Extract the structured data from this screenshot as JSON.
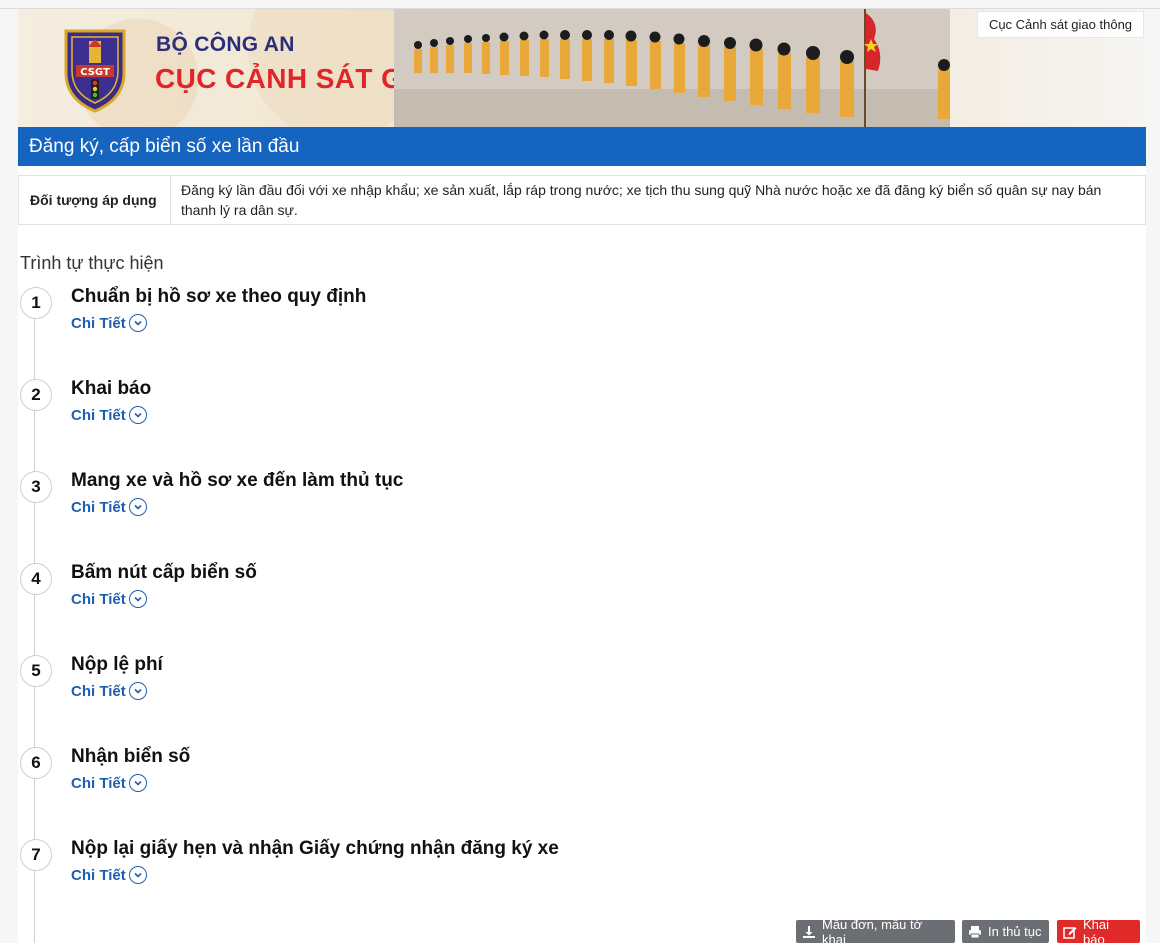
{
  "header": {
    "brand_top": "BỘ CÔNG AN",
    "brand_main": "CỤC CẢNH SÁT GIAO THÔNG",
    "logo_text": "CSGT",
    "agency_chip": "Cục Cảnh sát giao thông"
  },
  "procedure": {
    "title": "Đăng ký, cấp biển số xe lần đầu",
    "applicable_label": "Đối tượng áp dụng",
    "applicable_value": "Đăng ký lần đầu đối với xe nhập khẩu; xe sản xuất, lắp ráp trong nước; xe tịch thu sung quỹ Nhà nước hoặc xe đã đăng ký biển số quân sự nay bán thanh lý ra dân sự."
  },
  "steps_section": {
    "title": "Trình tự thực hiện",
    "detail_label": "Chi Tiết",
    "steps": [
      {
        "number": "1",
        "title": "Chuẩn bị hồ sơ xe theo quy định"
      },
      {
        "number": "2",
        "title": "Khai báo"
      },
      {
        "number": "3",
        "title": "Mang xe và hồ sơ xe đến làm thủ tục"
      },
      {
        "number": "4",
        "title": "Bấm nút cấp biển số"
      },
      {
        "number": "5",
        "title": "Nộp lệ phí"
      },
      {
        "number": "6",
        "title": "Nhận biển số"
      },
      {
        "number": "7",
        "title": "Nộp lại giấy hẹn và nhận Giấy chứng nhận đăng ký xe"
      }
    ]
  },
  "actions": {
    "forms_button": "Mẫu đơn, mẫu tờ khai",
    "print_button": "In thủ tục",
    "declare_button": "Khai báo"
  },
  "colors": {
    "title_bar": "#1565c0",
    "brand_red": "#e0262a",
    "brand_navy": "#2b2f7a",
    "detail_link": "#1f5fae",
    "declare_button": "#e02929"
  }
}
